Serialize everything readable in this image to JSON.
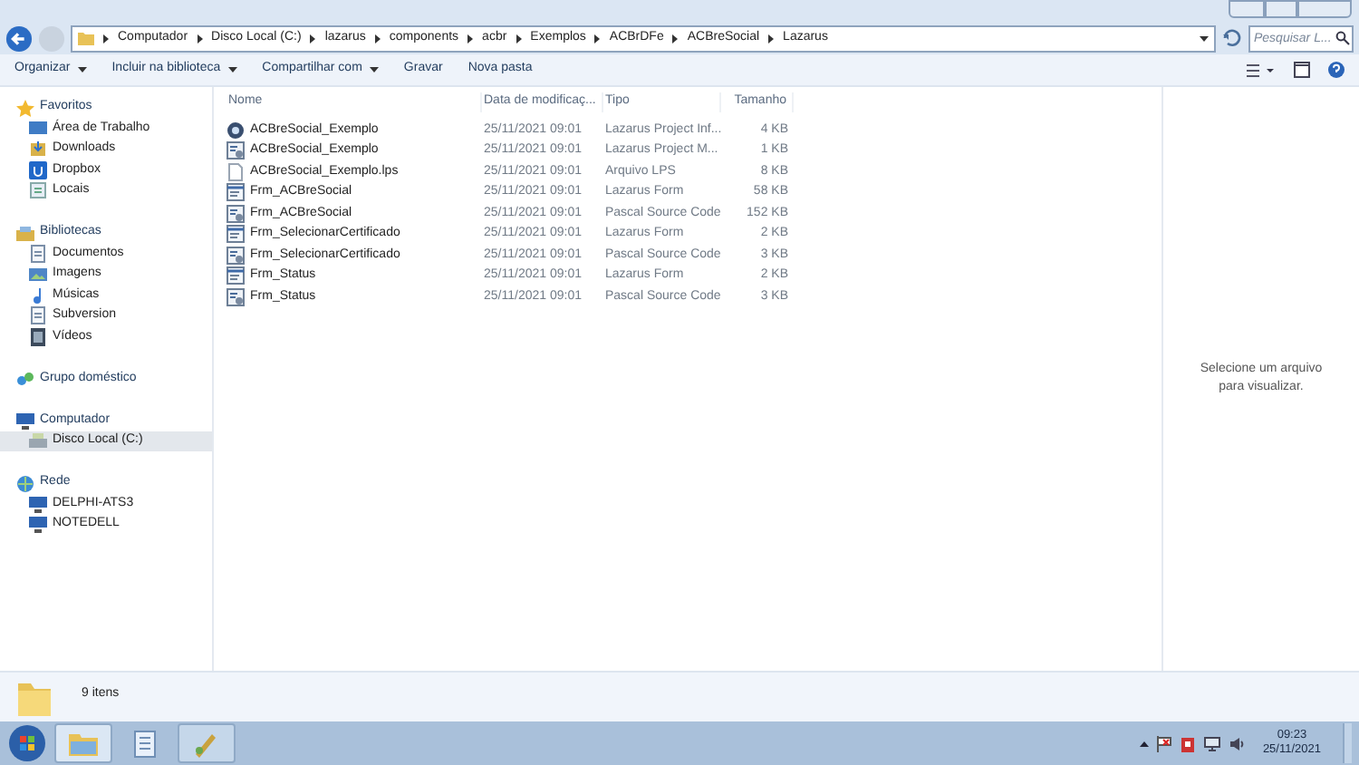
{
  "breadcrumb": [
    "Computador",
    "Disco Local (C:)",
    "lazarus",
    "components",
    "acbr",
    "Exemplos",
    "ACBrDFe",
    "ACBreSocial",
    "Lazarus"
  ],
  "search": {
    "placeholder": "Pesquisar L..."
  },
  "toolbar": [
    {
      "label": "Organizar",
      "dropdown": true
    },
    {
      "label": "Incluir na biblioteca",
      "dropdown": true
    },
    {
      "label": "Compartilhar com",
      "dropdown": true
    },
    {
      "label": "Gravar",
      "dropdown": false
    },
    {
      "label": "Nova pasta",
      "dropdown": false
    }
  ],
  "sidebar": [
    {
      "label": "Favoritos",
      "kind": "star",
      "selected": false,
      "children": [
        {
          "label": "Área de Trabalho",
          "kind": "desktop",
          "selected": false
        },
        {
          "label": "Downloads",
          "kind": "download",
          "selected": false
        },
        {
          "label": "Dropbox",
          "kind": "dropbox",
          "selected": false
        },
        {
          "label": "Locais",
          "kind": "places",
          "selected": false
        }
      ]
    },
    {
      "label": "Bibliotecas",
      "kind": "library",
      "selected": false,
      "children": [
        {
          "label": "Documentos",
          "kind": "doc",
          "selected": false
        },
        {
          "label": "Imagens",
          "kind": "image",
          "selected": false
        },
        {
          "label": "Músicas",
          "kind": "music",
          "selected": false
        },
        {
          "label": "Subversion",
          "kind": "doc",
          "selected": false
        },
        {
          "label": "Vídeos",
          "kind": "video",
          "selected": false
        }
      ]
    },
    {
      "label": "Grupo doméstico",
      "kind": "homegroup",
      "selected": false
    },
    {
      "label": "Computador",
      "kind": "computer",
      "selected": false,
      "children": [
        {
          "label": "Disco Local (C:)",
          "kind": "drive",
          "selected": true
        }
      ]
    },
    {
      "label": "Rede",
      "kind": "network",
      "selected": false,
      "children": [
        {
          "label": "DELPHI-ATS3",
          "kind": "computer",
          "selected": false
        },
        {
          "label": "NOTEDELL",
          "kind": "computer",
          "selected": false
        }
      ]
    }
  ],
  "table": {
    "columns": [
      "Nome",
      "Data de modificaç...",
      "Tipo",
      "Tamanho"
    ],
    "rows": [
      {
        "kind": "project",
        "name": "ACBreSocial_Exemplo",
        "date": "25/11/2021 09:01",
        "type": "Lazarus Project Inf...",
        "size": "4 KB"
      },
      {
        "kind": "source",
        "name": "ACBreSocial_Exemplo",
        "date": "25/11/2021 09:01",
        "type": "Lazarus Project M...",
        "size": "1 KB"
      },
      {
        "kind": "file",
        "name": "ACBreSocial_Exemplo.lps",
        "date": "25/11/2021 09:01",
        "type": "Arquivo LPS",
        "size": "8 KB"
      },
      {
        "kind": "form",
        "name": "Frm_ACBreSocial",
        "date": "25/11/2021 09:01",
        "type": "Lazarus Form",
        "size": "58 KB"
      },
      {
        "kind": "source",
        "name": "Frm_ACBreSocial",
        "date": "25/11/2021 09:01",
        "type": "Pascal Source Code",
        "size": "152 KB"
      },
      {
        "kind": "form",
        "name": "Frm_SelecionarCertificado",
        "date": "25/11/2021 09:01",
        "type": "Lazarus Form",
        "size": "2 KB"
      },
      {
        "kind": "source",
        "name": "Frm_SelecionarCertificado",
        "date": "25/11/2021 09:01",
        "type": "Pascal Source Code",
        "size": "3 KB"
      },
      {
        "kind": "form",
        "name": "Frm_Status",
        "date": "25/11/2021 09:01",
        "type": "Lazarus Form",
        "size": "2 KB"
      },
      {
        "kind": "source",
        "name": "Frm_Status",
        "date": "25/11/2021 09:01",
        "type": "Pascal Source Code",
        "size": "3 KB"
      }
    ]
  },
  "preview": "Selecione um arquivo para visualizar.",
  "details": "9 itens",
  "clock": {
    "time": "09:23",
    "date": "25/11/2021"
  }
}
